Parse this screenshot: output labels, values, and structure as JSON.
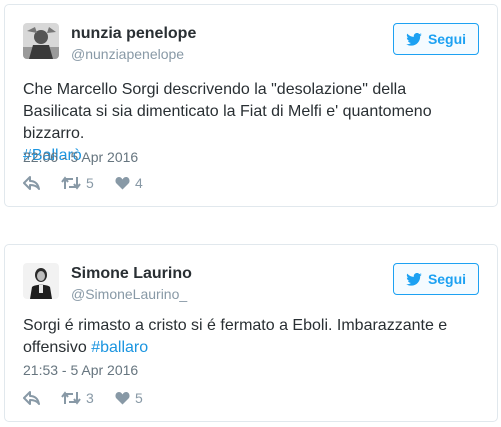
{
  "tweets": [
    {
      "name": "nunzia penelope",
      "handle": "@nunziapenelope",
      "follow_label": "Segui",
      "text": "Che Marcello Sorgi descrivendo la \"desolazione\" della Basilicata si sia dimenticato la Fiat di Melfi e' quantomeno bizzarro.",
      "hashtag": "#Ballarò",
      "timestamp": "22:06 - 5 Apr 2016",
      "retweets": "5",
      "likes": "4"
    },
    {
      "name": "Simone Laurino",
      "handle": "@SimoneLaurino_",
      "follow_label": "Segui",
      "text": "Sorgi é rimasto a cristo si é fermato a Eboli. Imbarazzante e offensivo",
      "hashtag": "#ballaro",
      "timestamp": "21:53 - 5 Apr 2016",
      "retweets": "3",
      "likes": "5"
    }
  ],
  "colors": {
    "accent": "#1da1f2",
    "hashtag": "#1b95e0",
    "muted": "#8899a6",
    "border": "#e1e8ed"
  },
  "icons": [
    "twitter-bird-icon",
    "reply-icon",
    "retweet-icon",
    "heart-icon"
  ]
}
